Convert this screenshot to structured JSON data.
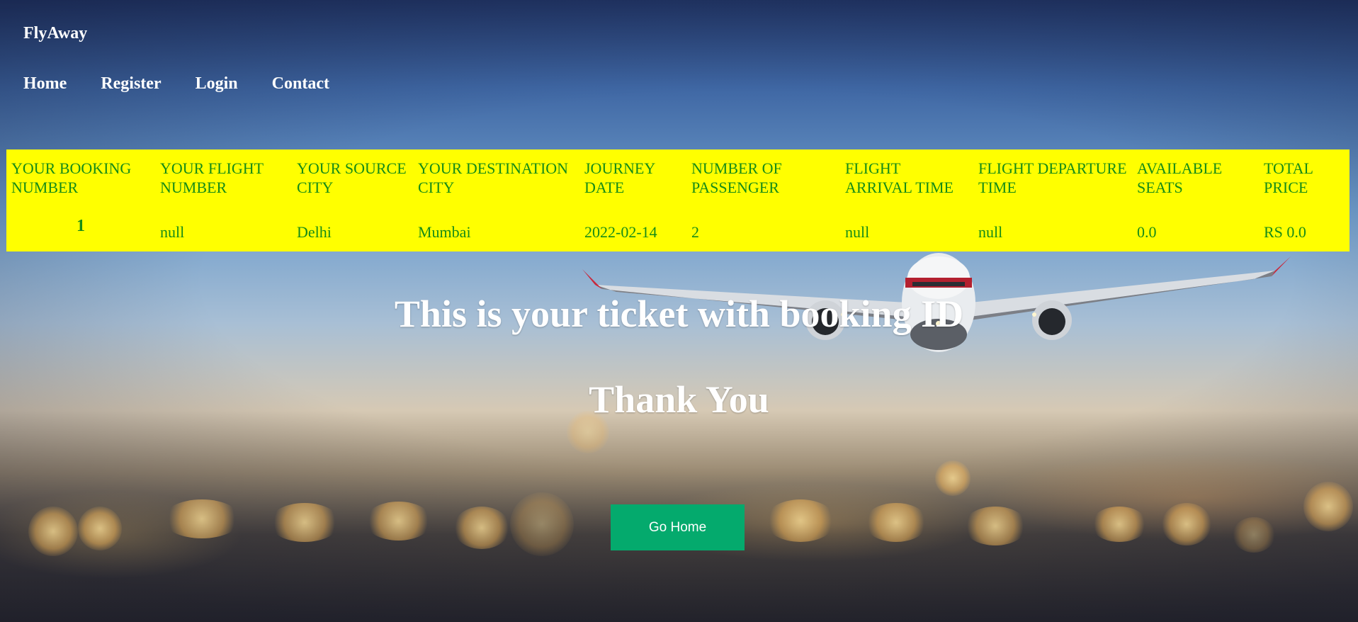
{
  "brand": {
    "name": "FlyAway"
  },
  "nav": [
    {
      "label": "Home"
    },
    {
      "label": "Register"
    },
    {
      "label": "Login"
    },
    {
      "label": "Contact"
    }
  ],
  "ticket": {
    "headers": [
      "YOUR BOOKING NUMBER",
      "YOUR FLIGHT NUMBER",
      "YOUR SOURCE CITY",
      "YOUR DESTINATION CITY",
      "JOURNEY DATE",
      "NUMBER OF PASSENGER",
      "FLIGHT ARRIVAL TIME",
      "FLIGHT DEPARTURE TIME",
      "AVAILABLE SEATS",
      "TOTAL PRICE"
    ],
    "row": [
      "1",
      "null",
      "Delhi",
      "Mumbai",
      "2022-02-14",
      "2",
      "null",
      "null",
      "0.0",
      "RS 0.0"
    ]
  },
  "messages": {
    "headline": "This is your ticket with booking ID",
    "thanks": "Thank You"
  },
  "actions": {
    "go_home": "Go Home"
  },
  "colors": {
    "ticket_bg": "#ffff00",
    "ticket_text": "#178c17",
    "button_bg": "#04aa6d"
  }
}
